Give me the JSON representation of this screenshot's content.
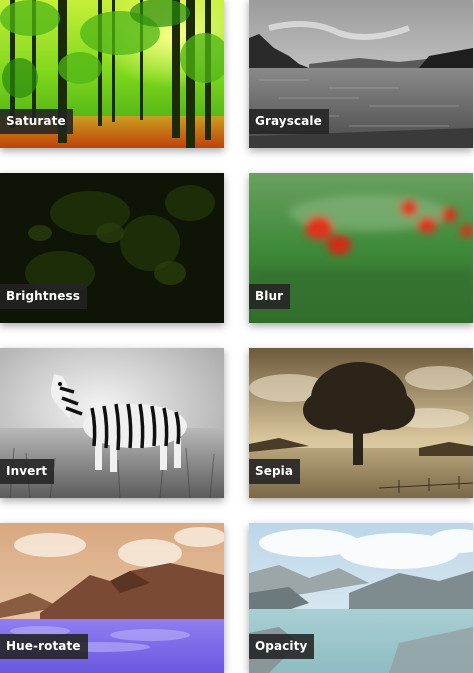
{
  "gallery": {
    "tiles": [
      {
        "label": "Saturate",
        "filter": "saturate",
        "accent": "#6fd21a"
      },
      {
        "label": "Grayscale",
        "filter": "grayscale",
        "accent": "#8a8a8a"
      },
      {
        "label": "Brightness",
        "filter": "brightness",
        "accent": "#0f1a06"
      },
      {
        "label": "Blur",
        "filter": "blur",
        "accent": "#3f8a3a"
      },
      {
        "label": "Invert",
        "filter": "invert",
        "accent": "#cfcfcf"
      },
      {
        "label": "Sepia",
        "filter": "sepia",
        "accent": "#b9a57c"
      },
      {
        "label": "Hue-rotate",
        "filter": "hue-rotate",
        "accent": "#8f7ff0"
      },
      {
        "label": "Opacity",
        "filter": "opacity",
        "accent": "#a9cfd3"
      }
    ]
  }
}
